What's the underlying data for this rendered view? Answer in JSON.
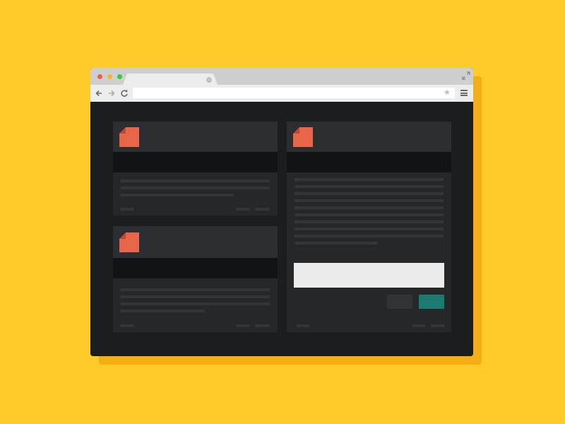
{
  "browser": {
    "tab_title": "",
    "address_value": "",
    "address_placeholder": "",
    "star_glyph": "★"
  },
  "cards": [
    {
      "title": "",
      "subtitle": "",
      "footer_left": "",
      "footer_right": ""
    },
    {
      "title": "",
      "subtitle": "",
      "footer_left": "",
      "footer_right": ""
    },
    {
      "title": "",
      "subtitle": "",
      "form_label": "",
      "textarea_value": "",
      "cancel_label": "",
      "submit_label": "",
      "footer_left": "",
      "footer_right": ""
    }
  ],
  "icons": {
    "window_controls": [
      "close-dot",
      "minimize-dot",
      "maximize-dot"
    ],
    "toolbar": [
      "back-arrow-icon",
      "forward-arrow-icon",
      "reload-icon",
      "star-icon",
      "menu-icon"
    ],
    "card": "document-icon",
    "window_expand": "expand-icon"
  },
  "colors": {
    "background": "#FFCB29",
    "window_shadow": "#F4AF16",
    "viewport": "#1C1D1F",
    "card": "#262729",
    "card_header": "#2D2E31",
    "card_subheader": "#121315",
    "document_icon": "#E8654A",
    "submit_button": "#1B7B70"
  }
}
